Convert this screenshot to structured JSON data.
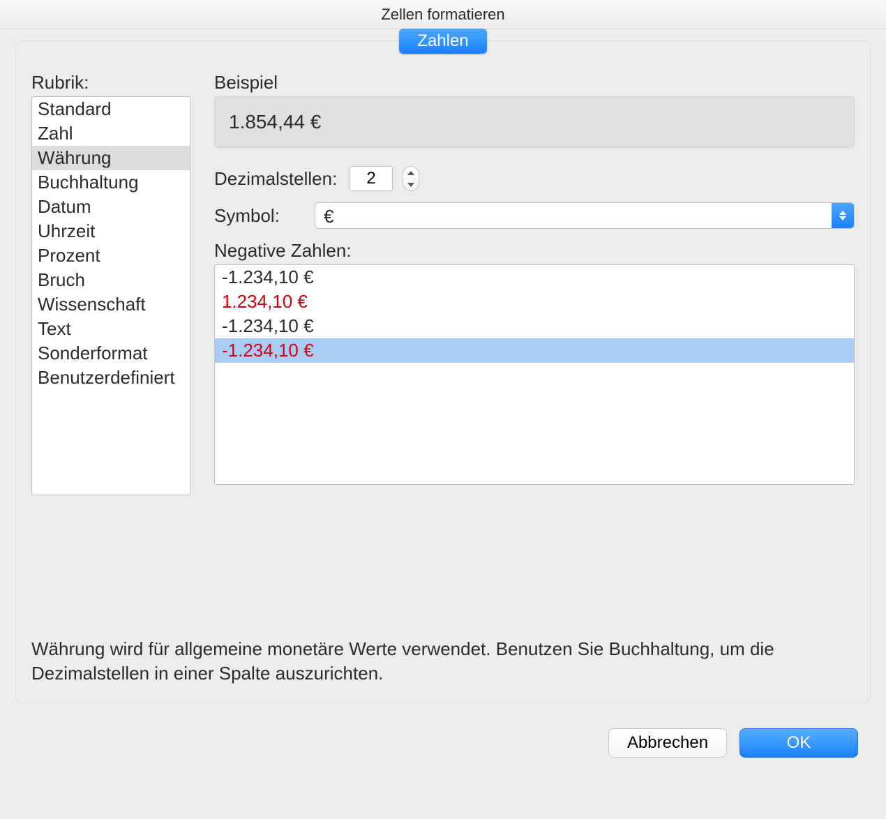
{
  "window": {
    "title": "Zellen formatieren"
  },
  "tab": {
    "label": "Zahlen"
  },
  "category": {
    "label": "Rubrik:",
    "items": [
      "Standard",
      "Zahl",
      "Währung",
      "Buchhaltung",
      "Datum",
      "Uhrzeit",
      "Prozent",
      "Bruch",
      "Wissenschaft",
      "Text",
      "Sonderformat",
      "Benutzerdefiniert"
    ],
    "selectedIndex": 2
  },
  "sample": {
    "label": "Beispiel",
    "value": "1.854,44 €"
  },
  "decimals": {
    "label": "Dezimalstellen:",
    "value": "2"
  },
  "symbol": {
    "label": "Symbol:",
    "value": "€"
  },
  "negative": {
    "label": "Negative Zahlen:",
    "items": [
      {
        "text": "-1.234,10 €",
        "red": false
      },
      {
        "text": "1.234,10 €",
        "red": true
      },
      {
        "text": "-1.234,10 €",
        "red": false
      },
      {
        "text": "-1.234,10 €",
        "red": true
      }
    ],
    "selectedIndex": 3
  },
  "description": "Währung wird für allgemeine monetäre Werte verwendet. Benutzen Sie Buchhaltung, um die Dezimalstellen in einer Spalte auszurichten.",
  "buttons": {
    "cancel": "Abbrechen",
    "ok": "OK"
  }
}
